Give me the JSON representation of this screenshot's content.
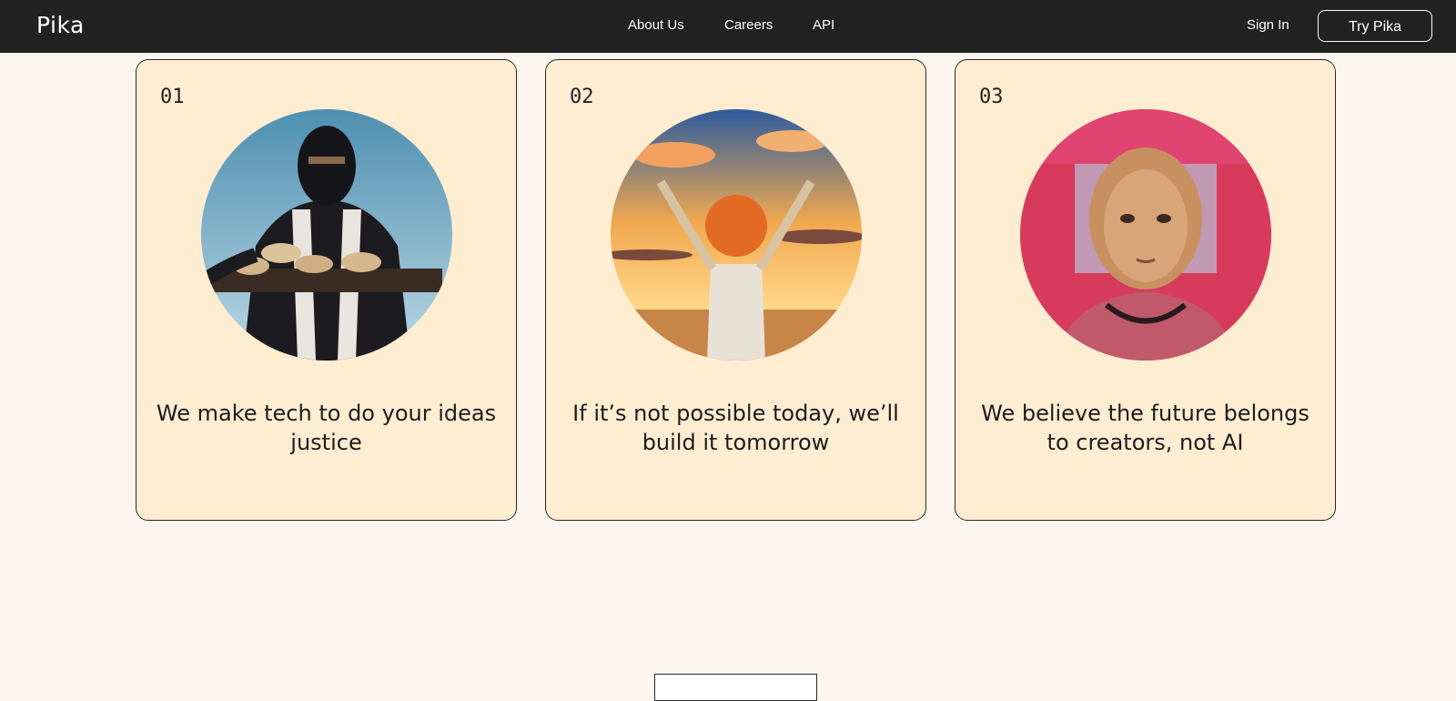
{
  "nav": {
    "logo": "Pika",
    "links": [
      "About Us",
      "Careers",
      "API"
    ],
    "sign_in": "Sign In",
    "try_button": "Try Pika"
  },
  "cards": [
    {
      "number": "01",
      "text": "We make tech to do your ideas justice",
      "image": "ninja-serving-cookies"
    },
    {
      "number": "02",
      "text": "If it’s not possible today, we’ll build it tomorrow",
      "image": "anime-child-sunset"
    },
    {
      "number": "03",
      "text": "We believe the future belongs to creators, not AI",
      "image": "girl-pink-room"
    }
  ],
  "colors": {
    "nav_bg": "#222222",
    "page_bg": "#fdf6ee",
    "card_bg": "#ffedd2",
    "border": "#2a2a2a"
  }
}
